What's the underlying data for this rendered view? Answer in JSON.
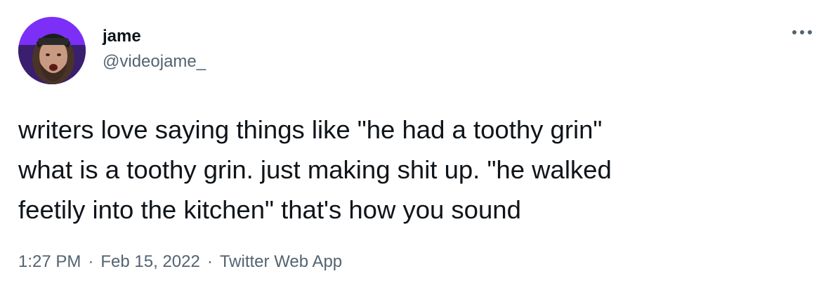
{
  "author": {
    "display_name": "jame",
    "handle": "@videojame_",
    "avatar_icon": "profile-photo",
    "avatar_ring_color": "#7b2ff7"
  },
  "more_icon": "more-horizontal-icon",
  "tweet": {
    "text": "writers love saying things like \"he had a toothy grin\"\nwhat is a toothy grin. just making shit up. \"he walked\nfeetily into the kitchen\" that's how you sound"
  },
  "meta": {
    "time": "1:27 PM",
    "separator": "·",
    "date": "Feb 15, 2022",
    "source": "Twitter Web App"
  },
  "colors": {
    "text_primary": "#0f1419",
    "text_secondary": "#536471",
    "background": "#ffffff"
  }
}
